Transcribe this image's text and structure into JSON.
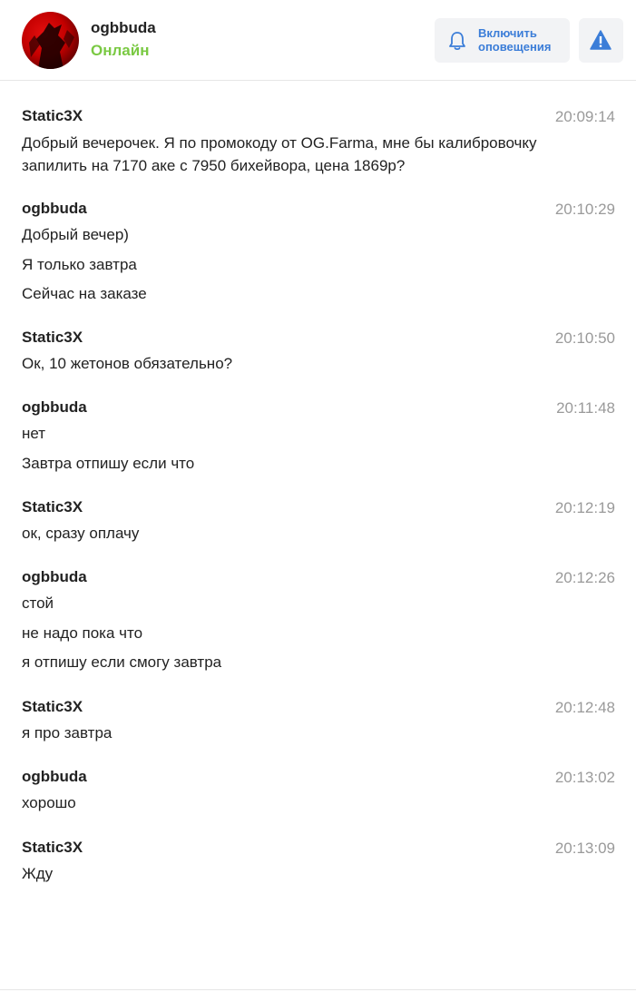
{
  "header": {
    "username": "ogbbuda",
    "status": "Онлайн",
    "notify_label": "Включить\nоповещения",
    "icons": {
      "notify": "bell-icon",
      "report": "warning-icon"
    },
    "colors": {
      "status": "#7ac943",
      "accent": "#3b7dd8",
      "avatar": "#c40000"
    }
  },
  "messages": [
    {
      "sender": "Static3X",
      "time": "20:09:14",
      "lines": [
        "Добрый вечерочек. Я по промокоду от OG.Farma, мне бы калибровочку запилить на 7170 аке с 7950 бихейвора, цена 1869р?"
      ]
    },
    {
      "sender": "ogbbuda",
      "time": "20:10:29",
      "lines": [
        "Добрый вечер)",
        "Я только завтра",
        "Сейчас на заказе"
      ]
    },
    {
      "sender": "Static3X",
      "time": "20:10:50",
      "lines": [
        "Ок, 10 жетонов обязательно?"
      ]
    },
    {
      "sender": "ogbbuda",
      "time": "20:11:48",
      "lines": [
        "нет",
        "Завтра отпишу если что"
      ]
    },
    {
      "sender": "Static3X",
      "time": "20:12:19",
      "lines": [
        "ок, сразу оплачу"
      ]
    },
    {
      "sender": "ogbbuda",
      "time": "20:12:26",
      "lines": [
        "стой",
        "не надо пока что",
        "я отпишу если смогу завтра"
      ]
    },
    {
      "sender": "Static3X",
      "time": "20:12:48",
      "lines": [
        "я про завтра"
      ]
    },
    {
      "sender": "ogbbuda",
      "time": "20:13:02",
      "lines": [
        "хорошо"
      ]
    },
    {
      "sender": "Static3X",
      "time": "20:13:09",
      "lines": [
        "Жду"
      ]
    }
  ]
}
